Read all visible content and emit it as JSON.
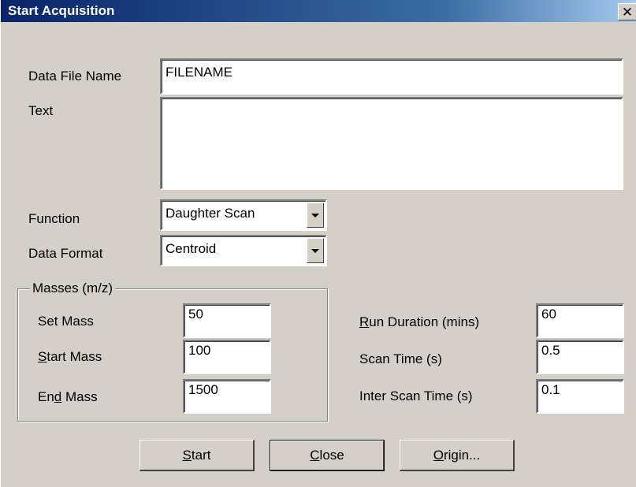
{
  "window": {
    "title": "Start Acquisition",
    "close_glyph": "✕"
  },
  "form": {
    "data_file_name_label": "Data File Name",
    "data_file_name_value": "FILENAME",
    "text_label": "Text",
    "text_value": "",
    "function_label": "Function",
    "function_value": "Daughter Scan",
    "data_format_label": "Data Format",
    "data_format_value": "Centroid"
  },
  "masses": {
    "group_label": "Masses (m/z)",
    "set_mass_label": "Set Mass",
    "set_mass_value": "50",
    "start_mass_label_pre": "",
    "start_mass_label_key": "S",
    "start_mass_label_post": "tart Mass",
    "start_mass_value": "100",
    "end_mass_label_pre": "En",
    "end_mass_label_key": "d",
    "end_mass_label_post": " Mass",
    "end_mass_value": "1500"
  },
  "timing": {
    "run_duration_label_key": "R",
    "run_duration_label_post": "un Duration (mins)",
    "run_duration_value": "60",
    "scan_time_label": "Scan Time (s)",
    "scan_time_value": "0.5",
    "inter_scan_time_label": "Inter Scan Time (s)",
    "inter_scan_time_value": "0.1"
  },
  "buttons": {
    "start_key": "S",
    "start_post": "tart",
    "close_key": "C",
    "close_post": "lose",
    "origin_key": "O",
    "origin_post": "rigin..."
  }
}
